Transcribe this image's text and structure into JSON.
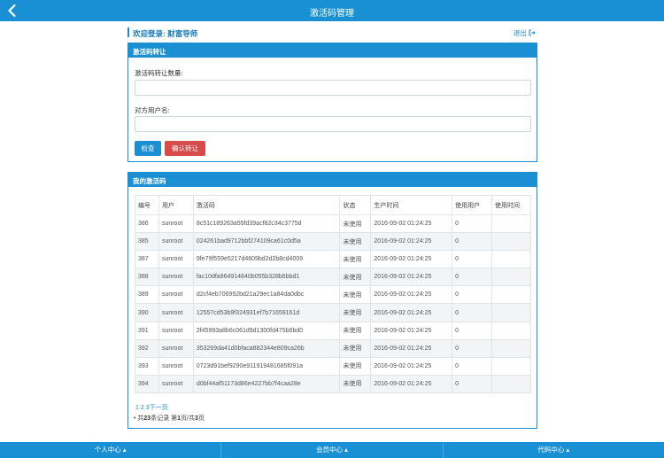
{
  "header": {
    "title": "激活码管理",
    "back_icon": "chevron-left-icon"
  },
  "welcome": {
    "text": "欢迎登录: 财富导师",
    "logout_label": "退出",
    "logout_icon": "sign-out-icon"
  },
  "transfer_panel": {
    "title": "激活码转让",
    "count_label": "激活码转让数量:",
    "count_value": "",
    "username_label": "对方用户名:",
    "username_value": "",
    "check_button": "检查",
    "confirm_button": "确认转让"
  },
  "codes_panel": {
    "title": "我的激活码",
    "columns": [
      "编号",
      "用户",
      "激活码",
      "状态",
      "生产时间",
      "使用用户",
      "使用时间"
    ],
    "rows": [
      [
        "386",
        "sunroot",
        "8c51c189263a55fd39acf82c34c3775d",
        "未使用",
        "2016-09-02 01:24:25",
        "0",
        ""
      ],
      [
        "385",
        "sunroot",
        "024261bad9712bbf274109ca61c0d5a",
        "未使用",
        "2016-09-02 01:24:25",
        "0",
        ""
      ],
      [
        "387",
        "sunroot",
        "9fe79f559e5217d4609bd2d2b8cd4009",
        "未使用",
        "2016-09-02 01:24:25",
        "0",
        ""
      ],
      [
        "388",
        "sunroot",
        "fac10dfa864914840b055b328b6bbd1",
        "未使用",
        "2016-09-02 01:24:25",
        "0",
        ""
      ],
      [
        "389",
        "sunroot",
        "d2cf4eb706992bd21a29ec1a84da0dbc",
        "未使用",
        "2016-09-02 01:24:25",
        "0",
        ""
      ],
      [
        "390",
        "sunroot",
        "12557cd53b9f324931ef7b71659161d",
        "未使用",
        "2016-09-02 01:24:25",
        "0",
        ""
      ],
      [
        "391",
        "sunroot",
        "2f45993a8b6c061d9d1300fd475b6bd0",
        "未使用",
        "2016-09-02 01:24:25",
        "0",
        ""
      ],
      [
        "392",
        "sunroot",
        "353269da41d0bfaca882344e809ca26b",
        "未使用",
        "2016-09-02 01:24:25",
        "0",
        ""
      ],
      [
        "393",
        "sunroot",
        "0723d91bef9290e911919481685f091a",
        "未使用",
        "2016-09-02 01:24:25",
        "0",
        ""
      ],
      [
        "394",
        "sunroot",
        "d0bf44af51173d86e4227bb7f4caa28e",
        "未使用",
        "2016-09-02 01:24:25",
        "0",
        ""
      ]
    ],
    "pager": {
      "p1": "1",
      "p2": "2",
      "p3": "3",
      "next": "下一页"
    },
    "summary": {
      "prefix": "共",
      "total": "23",
      "mid": "条记录 第",
      "page": "1",
      "mid2": "页/共",
      "pages": "3",
      "suffix": "页"
    }
  },
  "bottom_nav": {
    "personal": "个人中心 ▴",
    "member": "会员中心 ▴",
    "code": "代码中心 ▴"
  },
  "colors": {
    "primary": "#1990d3",
    "danger": "#d84b4b"
  }
}
